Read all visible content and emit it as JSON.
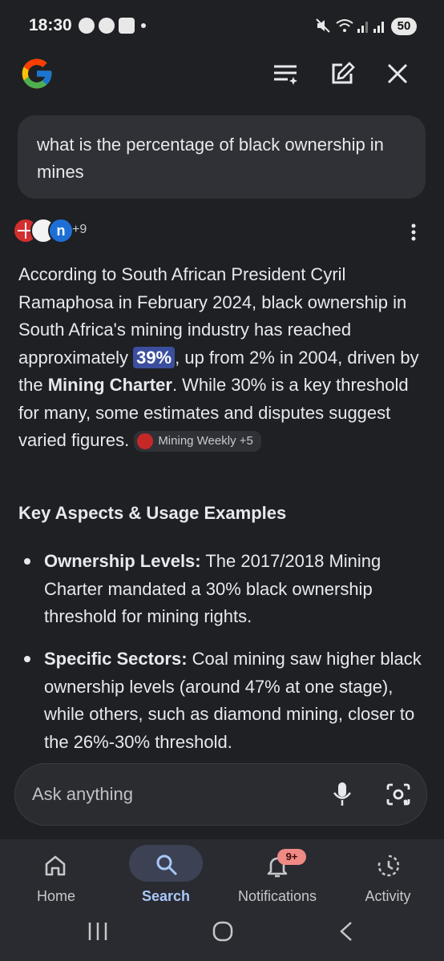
{
  "status_bar": {
    "time": "18:30",
    "battery": "50"
  },
  "query": {
    "text": "what is the percentage of black ownership in mines"
  },
  "sources": {
    "more_count": "+9"
  },
  "answer": {
    "p1": "According to South African President Cyril Ramaphosa in February 2024, black ownership in South Africa's mining industry has reached approximately ",
    "highlight": "39%",
    "p2": ", up from 2% in 2004, driven by the ",
    "bold": "Mining Charter",
    "p3": ". While 30% is a key threshold for many, some estimates and disputes suggest varied figures.",
    "chip": "Mining Weekly +5"
  },
  "section_heading": "Key Aspects & Usage Examples",
  "bullets": [
    {
      "label": "Ownership Levels:",
      "text": " The 2017/2018 Mining Charter mandated a 30% black ownership threshold for mining rights."
    },
    {
      "label": "Specific Sectors:",
      "text": " Coal mining saw higher black ownership levels (around 47% at one stage), while others, such as diamond mining, closer to the 26%-30% threshold."
    }
  ],
  "ask_bar": {
    "placeholder": "Ask anything"
  },
  "bottom_nav": {
    "items": [
      {
        "label": "Home"
      },
      {
        "label": "Search"
      },
      {
        "label": "Notifications"
      },
      {
        "label": "Activity"
      }
    ],
    "badge": "9+"
  },
  "colors": {
    "background": "#1f2024",
    "accent": "#a8c7fa",
    "highlight": "#3b4f9e",
    "badge": "#ef8a86"
  }
}
